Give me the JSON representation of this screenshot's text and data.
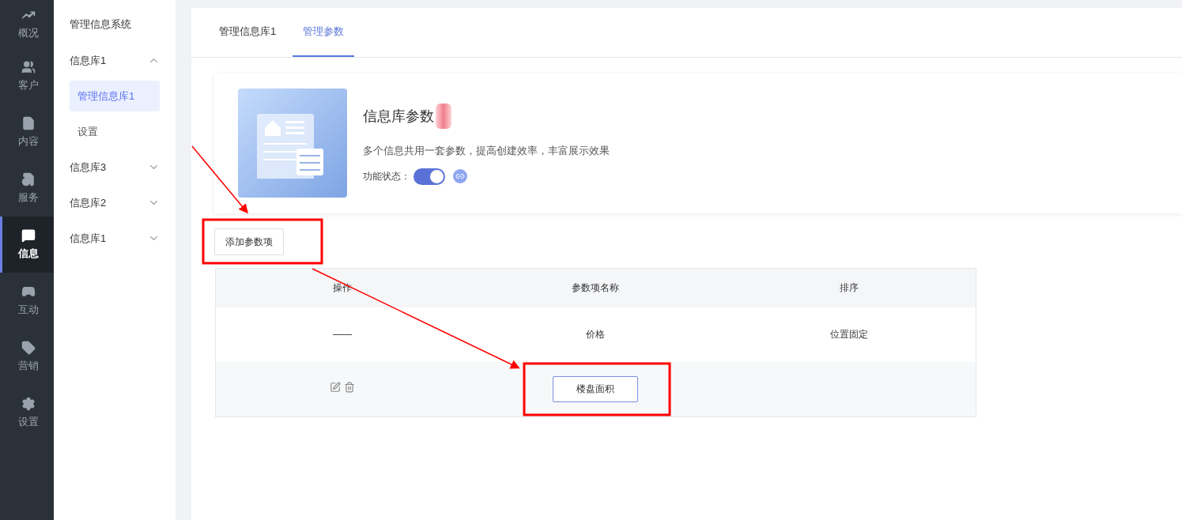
{
  "rail": [
    {
      "label": "概况",
      "selected": false
    },
    {
      "label": "客户",
      "selected": false
    },
    {
      "label": "内容",
      "selected": false
    },
    {
      "label": "服务",
      "selected": false
    },
    {
      "label": "信息",
      "selected": true
    },
    {
      "label": "互动",
      "selected": false
    },
    {
      "label": "营销",
      "selected": false
    },
    {
      "label": "设置",
      "selected": false
    }
  ],
  "sidebar": {
    "title": "管理信息系统",
    "groups": [
      {
        "label": "信息库1",
        "expanded": true,
        "children": [
          {
            "label": "管理信息库1",
            "selected": true
          },
          {
            "label": "设置",
            "selected": false
          }
        ]
      },
      {
        "label": "信息库3",
        "expanded": false
      },
      {
        "label": "信息库2",
        "expanded": false
      },
      {
        "label": "信息库1",
        "expanded": false
      }
    ]
  },
  "tabs": [
    {
      "label": "管理信息库1",
      "selected": false
    },
    {
      "label": "管理参数",
      "selected": true
    }
  ],
  "card": {
    "title": "信息库参数",
    "description": "多个信息共用一套参数，提高创建效率，丰富展示效果",
    "status_label": "功能状态：",
    "switch_on": true
  },
  "add_button": "添加参数项",
  "table": {
    "columns": [
      "操作",
      "参数项名称",
      "排序"
    ],
    "rows": [
      {
        "kind": "fixed",
        "action": "——",
        "name": "价格",
        "order": "位置固定"
      },
      {
        "kind": "editable",
        "name": "楼盘面积"
      }
    ]
  }
}
